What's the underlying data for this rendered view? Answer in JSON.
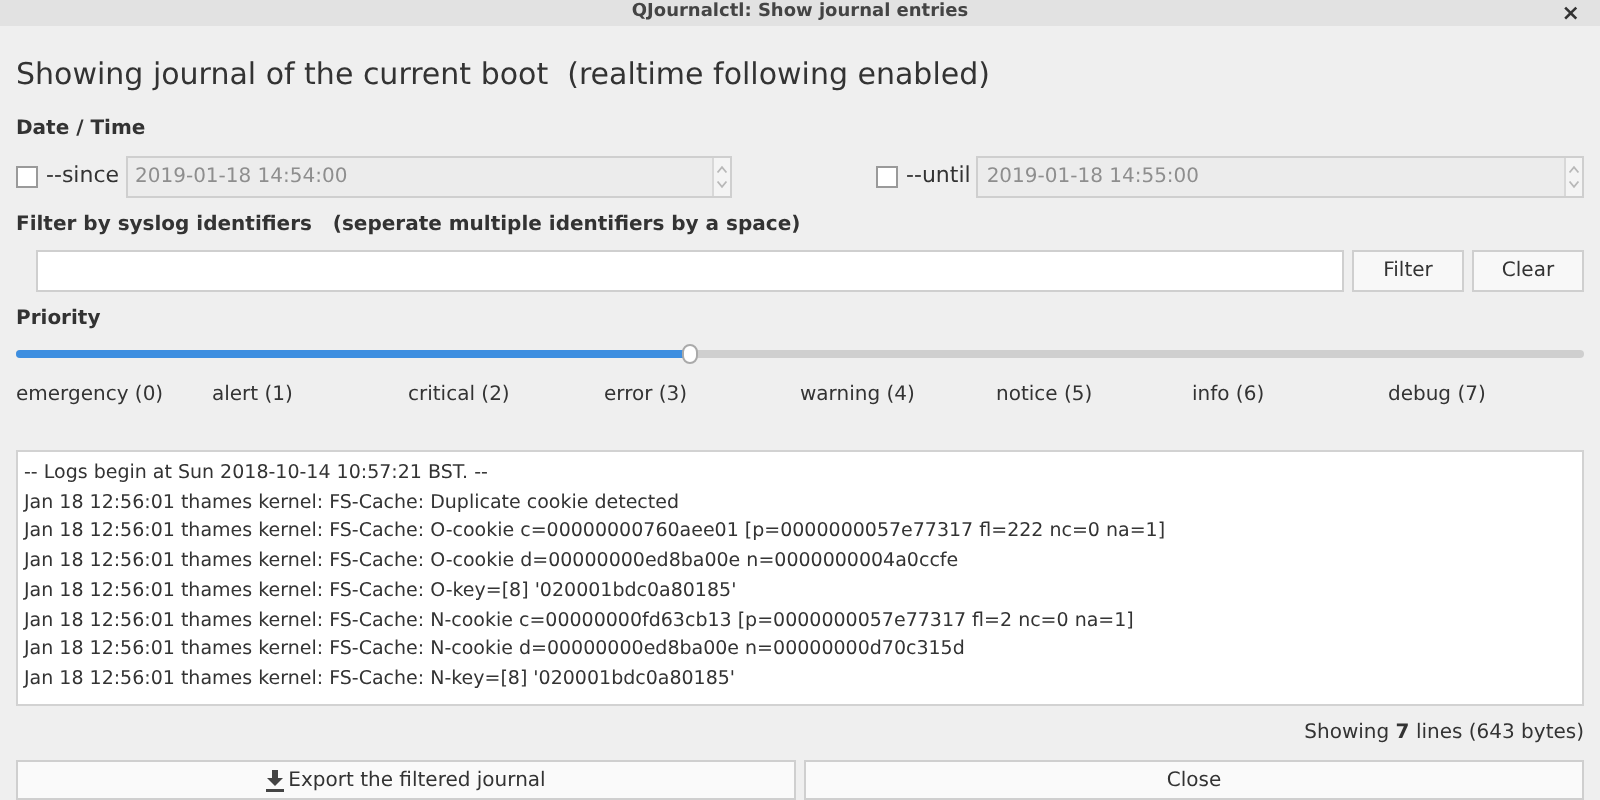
{
  "window": {
    "title": "QJournalctl: Show journal entries",
    "close": "×"
  },
  "heading": "Showing journal of the current boot  (realtime following enabled)",
  "datetime": {
    "label": "Date / Time",
    "since": {
      "label": "--since",
      "checked": false,
      "value": "2019-01-18 14:54:00",
      "disabled": true
    },
    "until": {
      "label": "--until",
      "checked": false,
      "value": "2019-01-18 14:55:00",
      "disabled": true
    }
  },
  "filter": {
    "label": "Filter by syslog identifiers   (seperate multiple identifiers by a space)",
    "buttons": [
      "Filter",
      "Clear"
    ]
  },
  "priority": {
    "label": "Priority",
    "level": 0.43,
    "ticks": [
      "emergency (0)",
      "alert (1)",
      "critical (2)",
      "error (3)",
      "warning (4)",
      "notice (5)",
      "info (6)",
      "debug (7)"
    ]
  },
  "log": [
    "-- Logs begin at Sun 2018-10-14 10:57:21 BST. --",
    "Jan 18 12:56:01 thames kernel: FS-Cache: Duplicate cookie detected",
    "Jan 18 12:56:01 thames kernel: FS-Cache: O-cookie c=00000000760aee01 [p=0000000057e77317 fl=222 nc=0 na=1]",
    "Jan 18 12:56:01 thames kernel: FS-Cache: O-cookie d=00000000ed8ba00e n=0000000004a0ccfe",
    "Jan 18 12:56:01 thames kernel: FS-Cache: O-key=[8] '020001bdc0a80185'",
    "Jan 18 12:56:01 thames kernel: FS-Cache: N-cookie c=00000000fd63cb13 [p=0000000057e77317 fl=2 nc=0 na=1]",
    "Jan 18 12:56:01 thames kernel: FS-Cache: N-cookie d=00000000ed8ba00e n=00000000d70c315d",
    "Jan 18 12:56:01 thames kernel: FS-Cache: N-key=[8] '020001bdc0a80185'"
  ],
  "status": "Showing **7** lines (643 bytes)",
  "buttons": [
    {
      "label": "Export the filtered journal",
      "kind": "export"
    },
    {
      "label": "Close",
      "kind": "plain"
    }
  ]
}
